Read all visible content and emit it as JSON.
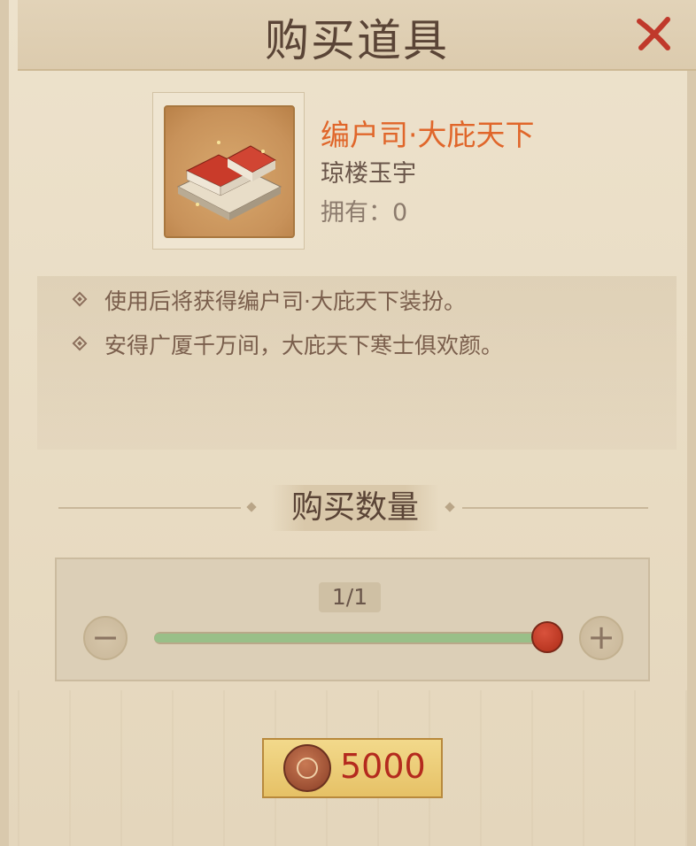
{
  "header": {
    "title": "购买道具"
  },
  "item": {
    "name": "编户司·大庇天下",
    "subtitle": "琼楼玉宇",
    "owned": "拥有：0"
  },
  "description": [
    "使用后将获得编户司·大庇天下装扮。",
    "安得广厦千万间，大庇天下寒士俱欢颜。"
  ],
  "quantity": {
    "section_title": "购买数量",
    "label": "1/1",
    "value": 1,
    "max": 1,
    "minus_icon": "−",
    "plus_icon": "+"
  },
  "purchase": {
    "price": "5000"
  },
  "colors": {
    "item_name": "#e0662a",
    "price": "#b42a1e",
    "slider_fill": "#99bf88",
    "knob": "#b6341f"
  }
}
